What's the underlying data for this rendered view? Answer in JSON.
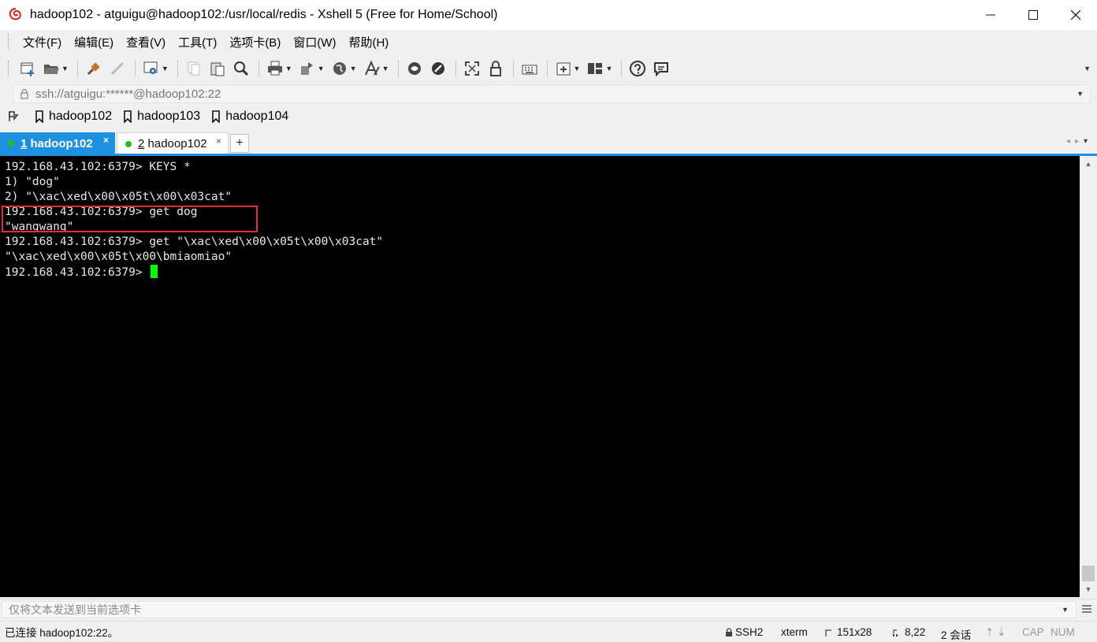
{
  "window": {
    "title": "hadoop102 - atguigu@hadoop102:/usr/local/redis - Xshell 5 (Free for Home/School)",
    "minimize": "—",
    "maximize": "☐",
    "close": "✕"
  },
  "menu": [
    "文件(F)",
    "编辑(E)",
    "查看(V)",
    "工具(T)",
    "选项卡(B)",
    "窗口(W)",
    "帮助(H)"
  ],
  "address": {
    "text": "ssh://atguigu:******@hadoop102:22"
  },
  "links": [
    "hadoop102",
    "hadoop103",
    "hadoop104"
  ],
  "tabs": [
    {
      "number": "1",
      "label": " hadoop102",
      "close": "×",
      "active": true
    },
    {
      "number": "2",
      "label": " hadoop102",
      "close": "×",
      "active": false
    }
  ],
  "tab_add": "+",
  "terminal": {
    "lines": [
      "192.168.43.102:6379> KEYS *",
      "1) \"dog\"",
      "2) \"\\xac\\xed\\x00\\x05t\\x00\\x03cat\"",
      "192.168.43.102:6379> get dog",
      "\"wangwang\"",
      "192.168.43.102:6379> get \"\\xac\\xed\\x00\\x05t\\x00\\x03cat\"",
      "\"\\xac\\xed\\x00\\x05t\\x00\\bmiaomiao\"",
      "192.168.43.102:6379> "
    ],
    "cursor_color": "#00ff00",
    "highlight_color": "#e03030"
  },
  "compose": {
    "placeholder": "仅将文本发送到当前选项卡"
  },
  "status": {
    "connection": "已连接 hadoop102:22。",
    "protocol": "SSH2",
    "terminal_type": "xterm",
    "size": "151x28",
    "cursor_pos": "8,22",
    "sessions": "2 会话",
    "caps": "CAP",
    "num": "NUM"
  },
  "colors": {
    "accent": "#1e90e0",
    "terminal_bg": "#000000",
    "terminal_fg": "#e8e8e8"
  }
}
